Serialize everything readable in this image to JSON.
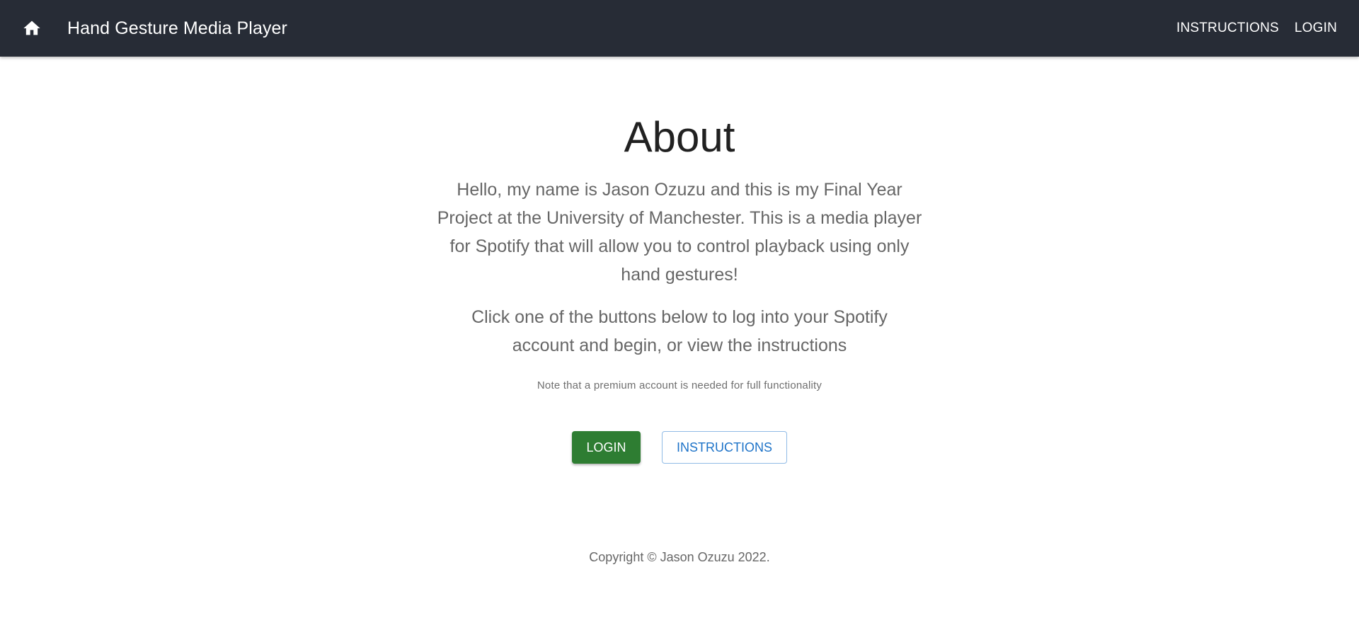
{
  "header": {
    "home_icon": "home-icon",
    "title": "Hand Gesture Media Player",
    "nav": {
      "instructions_label": "INSTRUCTIONS",
      "login_label": "LOGIN"
    },
    "background_color": "#272c36"
  },
  "main": {
    "title": "About",
    "intro": "Hello, my name is Jason Ozuzu and this is my Final Year Project at the University of Manchester. This is a media player for Spotify that will allow you to control playback using only hand gestures!",
    "call_to_action": "Click one of the buttons below to log into your Spotify account and begin, or view the instructions",
    "note": "Note that a premium account is needed for full functionality",
    "buttons": {
      "login_label": "LOGIN",
      "instructions_label": "INSTRUCTIONS"
    }
  },
  "footer": {
    "copyright": "Copyright © Jason Ozuzu 2022."
  },
  "colors": {
    "login_button": "#2e7d32",
    "instructions_button_text": "#1e73c8"
  }
}
